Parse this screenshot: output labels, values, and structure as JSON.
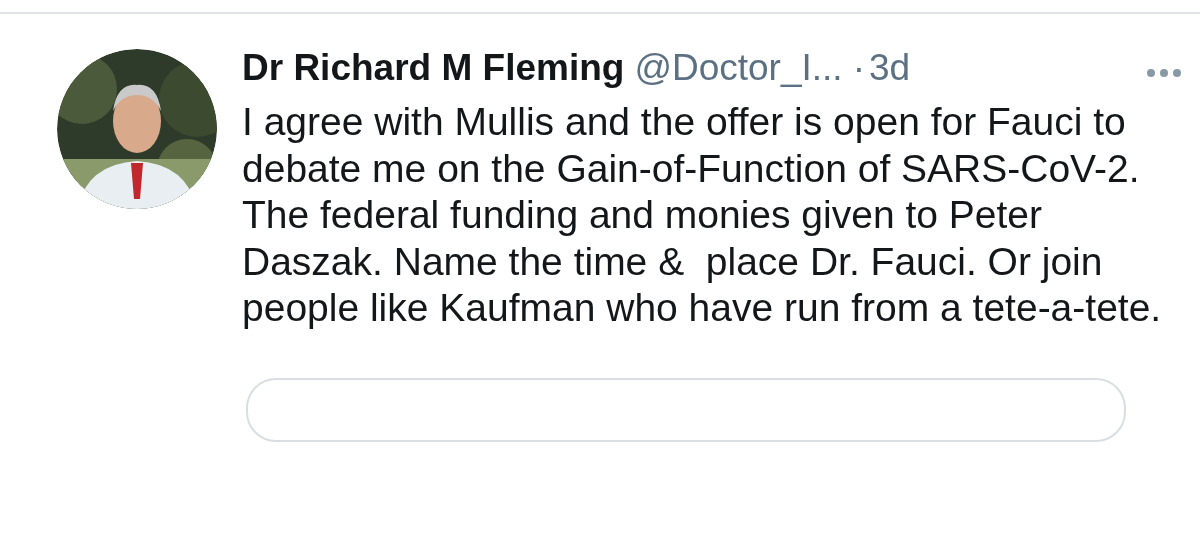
{
  "tweet": {
    "author_name": "Dr Richard M Fleming",
    "handle": "@Doctor_I...",
    "separator": "·",
    "time": "3d",
    "text": "I agree with Mullis and the offer is open for Fauci to debate me on the Gain-of-Function of SARS-CoV-2. The federal funding and monies given to Peter Daszak. Name the time &  place Dr. Fauci. Or join people like Kaufman who have run from a tete-a-tete."
  }
}
